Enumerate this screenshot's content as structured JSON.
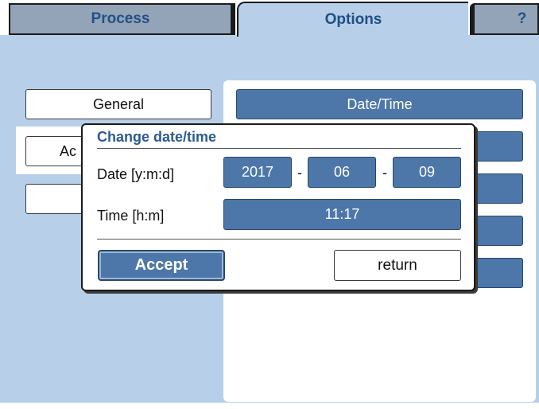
{
  "tabs": {
    "process": "Process",
    "options": "Options",
    "help": "?"
  },
  "left_menu": {
    "general": "General",
    "second": "Ac"
  },
  "options_list": {
    "date_time": "Date/Time"
  },
  "dialog": {
    "title": "Change date/time",
    "date_label": "Date [y:m:d]",
    "year": "2017",
    "month": "06",
    "day": "09",
    "separator": "-",
    "time_label": "Time [h:m]",
    "time": "11:17",
    "accept": "Accept",
    "return": "return"
  },
  "colors": {
    "panel_background": "#b7cfe9",
    "field_blue": "#4d77a8",
    "title_blue": "#2d5a8d"
  }
}
